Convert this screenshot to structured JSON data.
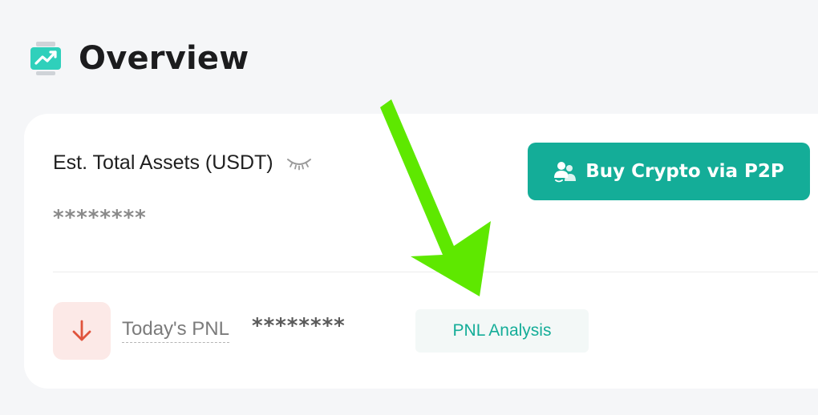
{
  "header": {
    "title": "Overview",
    "icon": "chart-monitor-icon"
  },
  "assets": {
    "label": "Est. Total Assets (USDT)",
    "value": "********",
    "visibility_icon": "eye-closed-icon"
  },
  "buy_button": {
    "label": "Buy Crypto via P2P",
    "icon": "users-exchange-icon"
  },
  "pnl": {
    "icon": "arrow-down-icon",
    "label": "Today's PNL",
    "value": "********",
    "analysis_label": "PNL Analysis"
  },
  "annotation": {
    "type": "green-pointer-arrow",
    "color": "#5ee800"
  },
  "colors": {
    "accent": "#14ad98",
    "negative": "#e0533c",
    "negative_bg": "#fce9e7",
    "page_bg": "#f5f6f8"
  }
}
